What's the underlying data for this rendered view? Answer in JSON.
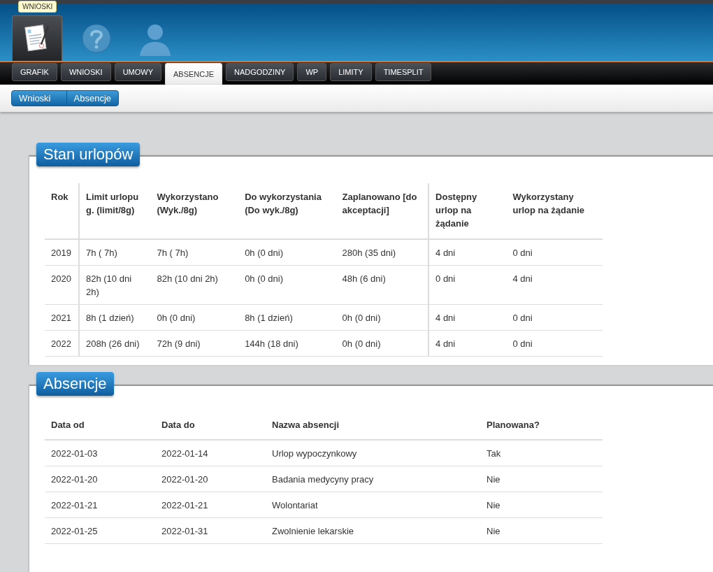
{
  "header": {
    "tooltip": "WNIOSKI",
    "icons": [
      {
        "kind": "document",
        "selected": true
      },
      {
        "kind": "help",
        "selected": false
      },
      {
        "kind": "user",
        "selected": false
      }
    ]
  },
  "tabs": [
    {
      "label": "GRAFIK",
      "selected": false
    },
    {
      "label": "WNIOSKI",
      "selected": false
    },
    {
      "label": "UMOWY",
      "selected": false
    },
    {
      "label": "ABSENCJE",
      "selected": true
    },
    {
      "label": "NADGODZINY",
      "selected": false
    },
    {
      "label": "WP",
      "selected": false
    },
    {
      "label": "LIMITY",
      "selected": false
    },
    {
      "label": "TIMESPLIT",
      "selected": false
    }
  ],
  "breadcrumb": [
    "Wnioski",
    "Absencje"
  ],
  "leave_panel": {
    "title": "Stan urlopów",
    "columns": [
      "Rok",
      "Limit urlopu g. (limit/8g)",
      "Wykorzystano (Wyk./8g)",
      "Do wykorzystania (Do wyk./8g)",
      "Zaplanowano [do akceptacji]",
      "Dostępny urlop na żądanie",
      "Wykorzystany urlop na żądanie"
    ],
    "rows": [
      [
        "2019",
        "7h ( 7h)",
        "7h ( 7h)",
        "0h (0 dni)",
        "280h (35 dni)",
        "4 dni",
        "0 dni"
      ],
      [
        "2020",
        "82h (10 dni 2h)",
        "82h (10 dni 2h)",
        "0h (0 dni)",
        "48h (6 dni)",
        "0 dni",
        "4 dni"
      ],
      [
        "2021",
        "8h (1 dzień)",
        "0h (0 dni)",
        "8h (1 dzień)",
        "0h (0 dni)",
        "4 dni",
        "0 dni"
      ],
      [
        "2022",
        "208h (26 dni)",
        "72h (9 dni)",
        "144h (18 dni)",
        "0h (0 dni)",
        "4 dni",
        "0 dni"
      ]
    ]
  },
  "absence_panel": {
    "title": "Absencje",
    "columns": [
      "Data od",
      "Data do",
      "Nazwa absencji",
      "Planowana?"
    ],
    "rows": [
      [
        "2022-01-03",
        "2022-01-14",
        "Urlop wypoczynkowy",
        "Tak"
      ],
      [
        "2022-01-20",
        "2022-01-20",
        "Badania medycyny pracy",
        "Nie"
      ],
      [
        "2022-01-21",
        "2022-01-21",
        "Wolontariat",
        "Nie"
      ],
      [
        "2022-01-25",
        "2022-01-31",
        "Zwolnienie lekarskie",
        "Nie"
      ]
    ]
  }
}
